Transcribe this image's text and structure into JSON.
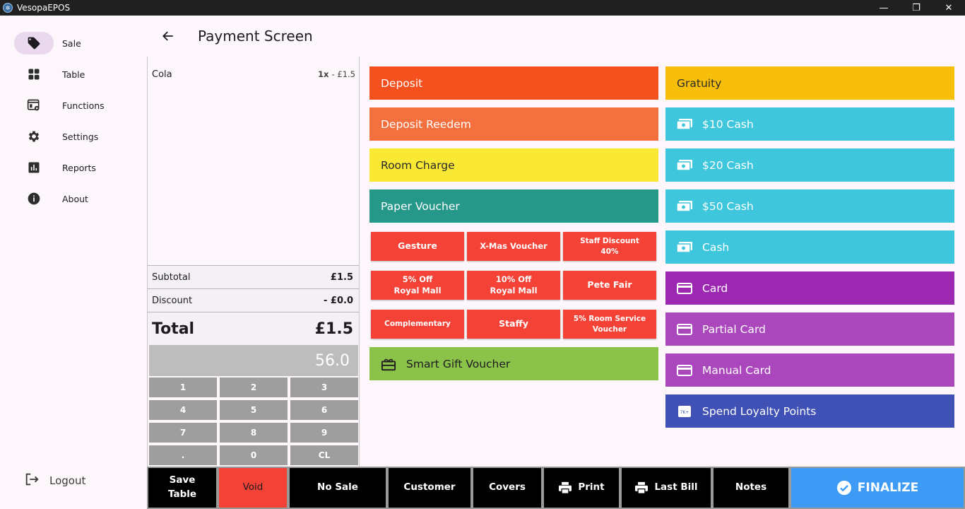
{
  "window": {
    "title": "VesopaEPOS",
    "controls": [
      "—",
      "❐",
      "✕"
    ]
  },
  "sidebar": {
    "items": [
      {
        "label": "Sale",
        "icon": "tag-icon",
        "active": true
      },
      {
        "label": "Table",
        "icon": "grid-icon"
      },
      {
        "label": "Functions",
        "icon": "functions-icon"
      },
      {
        "label": "Settings",
        "icon": "gear-icon"
      },
      {
        "label": "Reports",
        "icon": "bar-chart-icon"
      },
      {
        "label": "About",
        "icon": "info-icon"
      }
    ],
    "logout": "Logout"
  },
  "header": {
    "title": "Payment Screen"
  },
  "order": {
    "items": [
      {
        "name": "Cola",
        "qty": "1x",
        "price": "- £1.5"
      }
    ],
    "subtotal_label": "Subtotal",
    "subtotal_value": "£1.5",
    "discount_label": "Discount",
    "discount_value": "- £0.0",
    "total_label": "Total",
    "total_value": "£1.5",
    "amount_entered": "56.0",
    "keypad": [
      "1",
      "2",
      "3",
      "4",
      "5",
      "6",
      "7",
      "8",
      "9",
      ".",
      "0",
      "CL"
    ]
  },
  "tenders_left": {
    "deposit": "Deposit",
    "deposit_redeem": "Deposit Reedem",
    "room_charge": "Room Charge",
    "paper_voucher": "Paper Voucher",
    "discounts": [
      [
        "Gesture"
      ],
      [
        "X-Mas Voucher"
      ],
      [
        "Staff Discount",
        "40%"
      ],
      [
        "5% Off",
        "Royal Mall"
      ],
      [
        "10% Off",
        "Royal Mall"
      ],
      [
        "Pete Fair"
      ],
      [
        "Complementary"
      ],
      [
        "Staffy"
      ],
      [
        "5% Room Service",
        "Voucher"
      ]
    ],
    "smart_gift": "Smart Gift Voucher"
  },
  "tenders_right": {
    "gratuity": "Gratuity",
    "cash10": "$10 Cash",
    "cash20": "$20 Cash",
    "cash50": "$50 Cash",
    "cash": "Cash",
    "card": "Card",
    "partial_card": "Partial Card",
    "manual_card": "Manual Card",
    "loyalty": "Spend Loyalty Points"
  },
  "bottom": {
    "save_table": [
      "Save",
      "Table"
    ],
    "void": "Void",
    "no_sale": "No Sale",
    "customer": "Customer",
    "covers": "Covers",
    "print": "Print",
    "last_bill": "Last Bill",
    "notes": "Notes",
    "finalize": "FINALIZE"
  },
  "colors": {
    "deposit": "#f4511e",
    "deposit_redeem": "#f4703f",
    "room_charge": "#f9e935",
    "paper_voucher": "#26988a",
    "discount_red": "#f44336",
    "smart_gift": "#8bc34a",
    "gratuity": "#f7bf0a",
    "cash": "#3ec6dc",
    "card": "#9c27b0",
    "card_light": "#ab47bc",
    "loyalty": "#3f51b5",
    "finalize": "#3d9af5",
    "void": "#f44336"
  }
}
